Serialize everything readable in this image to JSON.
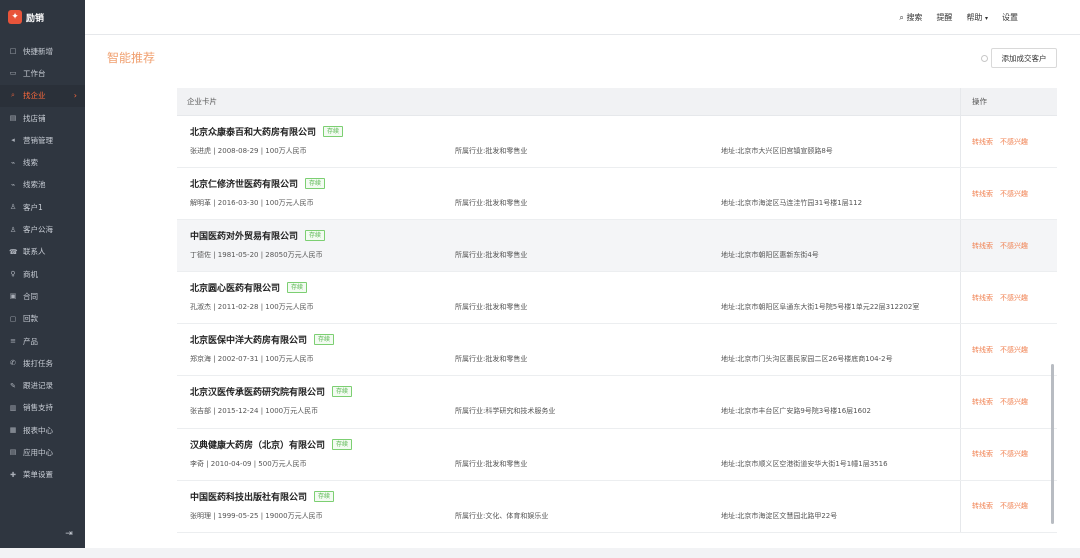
{
  "app": {
    "logo_text": "励销"
  },
  "sidebar": {
    "items": [
      {
        "label": "快捷新增",
        "icon": "□"
      },
      {
        "label": "工作台",
        "icon": "▭"
      },
      {
        "label": "找企业",
        "icon": "⌕",
        "active": true
      },
      {
        "label": "找店铺",
        "icon": "▤"
      },
      {
        "label": "营销管理",
        "icon": "◂"
      },
      {
        "label": "线索",
        "icon": "⌁"
      },
      {
        "label": "线索池",
        "icon": "⌁"
      },
      {
        "label": "客户1",
        "icon": "♙"
      },
      {
        "label": "客户公海",
        "icon": "♙"
      },
      {
        "label": "联系人",
        "icon": "☎"
      },
      {
        "label": "商机",
        "icon": "♀"
      },
      {
        "label": "合同",
        "icon": "▣"
      },
      {
        "label": "回款",
        "icon": "▢"
      },
      {
        "label": "产品",
        "icon": "≡"
      },
      {
        "label": "拨打任务",
        "icon": "✆"
      },
      {
        "label": "跟进记录",
        "icon": "✎"
      },
      {
        "label": "销售支持",
        "icon": "▥"
      },
      {
        "label": "报表中心",
        "icon": "▦"
      },
      {
        "label": "应用中心",
        "icon": "▤"
      },
      {
        "label": "菜单设置",
        "icon": "✚"
      }
    ],
    "arrow": "›",
    "collapse_icon": "⇥"
  },
  "topnav": {
    "search": "搜索",
    "remind": "提醒",
    "help": "帮助",
    "help_arrow": "▾",
    "settings": "设置"
  },
  "page": {
    "title": "智能推荐",
    "add_button": "添加成交客户"
  },
  "table": {
    "header_card": "企业卡片",
    "header_ops": "操作",
    "op_to_lead": "转线索",
    "op_not_interested": "不感兴趣",
    "rows": [
      {
        "name": "北京众康泰百和大药房有限公司",
        "tag": "存续",
        "info": "张进虎 | 2008-08-29 | 100万人民币",
        "industry": "所属行业:批发和零售业",
        "address": "地址:北京市大兴区旧宫镇宣颐路8号"
      },
      {
        "name": "北京仁修济世医药有限公司",
        "tag": "存续",
        "info": "解明革 | 2016-03-30 | 100万元人民币",
        "industry": "所属行业:批发和零售业",
        "address": "地址:北京市海淀区马连洼竹园31号楼1层112"
      },
      {
        "name": "中国医药对外贸易有限公司",
        "tag": "存续",
        "info": "丁德佐 | 1981-05-20 | 28050万元人民币",
        "industry": "所属行业:批发和零售业",
        "address": "地址:北京市朝阳区惠新东街4号"
      },
      {
        "name": "北京圆心医药有限公司",
        "tag": "存续",
        "info": "孔淑杰 | 2011-02-28 | 100万元人民币",
        "industry": "所属行业:批发和零售业",
        "address": "地址:北京市朝阳区阜通东大街1号院5号楼1单元22层312202室"
      },
      {
        "name": "北京医保中洋大药房有限公司",
        "tag": "存续",
        "info": "郑京海 | 2002-07-31 | 100万元人民币",
        "industry": "所属行业:批发和零售业",
        "address": "地址:北京市门头沟区惠民家园二区26号楼底商104-2号"
      },
      {
        "name": "北京汉医传承医药研究院有限公司",
        "tag": "存续",
        "info": "张吉部 | 2015-12-24 | 1000万元人民币",
        "industry": "所属行业:科学研究和技术服务业",
        "address": "地址:北京市丰台区广安路9号院3号楼16层1602"
      },
      {
        "name": "汉典健康大药房（北京）有限公司",
        "tag": "存续",
        "info": "李奇 | 2010-04-09 | 500万元人民币",
        "industry": "所属行业:批发和零售业",
        "address": "地址:北京市顺义区空港街道安华大街1号1幢1层3516"
      },
      {
        "name": "中国医药科技出版社有限公司",
        "tag": "存续",
        "info": "张明理 | 1999-05-25 | 19000万元人民币",
        "industry": "所属行业:文化、体育和娱乐业",
        "address": "地址:北京市海淀区文慧园北路甲22号"
      }
    ]
  }
}
